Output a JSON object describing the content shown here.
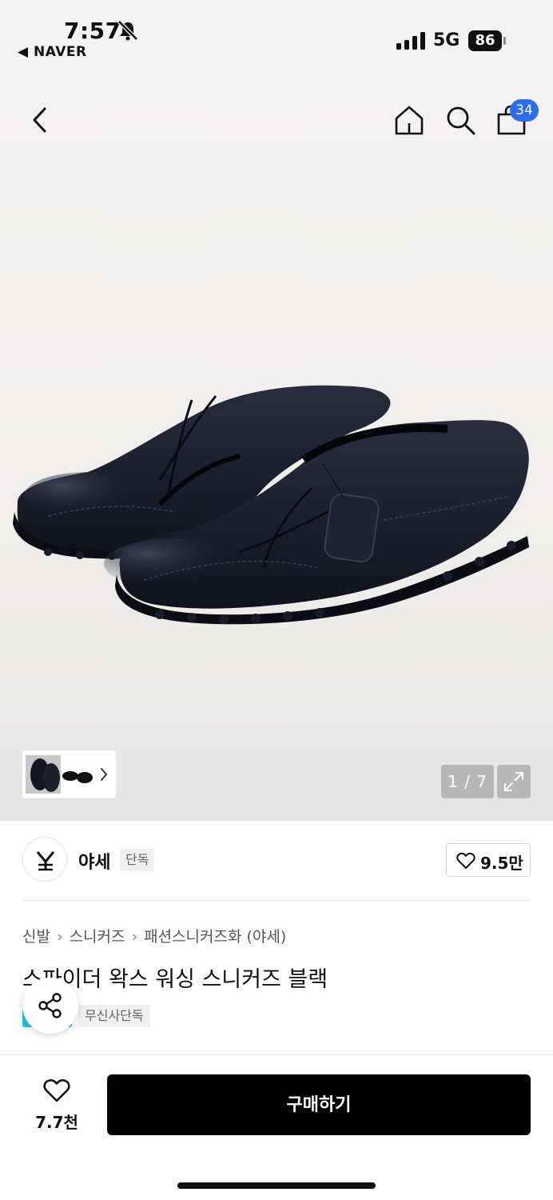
{
  "status_bar": {
    "time": "7:57",
    "back_app": "◀ NAVER",
    "network": "5G",
    "battery": "86"
  },
  "header": {
    "cart_count": "34"
  },
  "gallery": {
    "counter": "1 / 7"
  },
  "brand": {
    "name": "야세",
    "tag": "단독",
    "like_count": "9.5만"
  },
  "breadcrumb": [
    "신발",
    "스니커즈",
    "패션스니커즈화 (야세)"
  ],
  "product": {
    "title": "스파이더 왁스 워싱 스니커즈 블랙",
    "exclusive_tag": "무신사단독"
  },
  "bottom_bar": {
    "wish_count": "7.7천",
    "buy_label": "구매하기"
  },
  "colors": {
    "accent_blue": "#2f6bef",
    "buy_button": "#000000",
    "chip_cyan": "#1cc5e0"
  }
}
